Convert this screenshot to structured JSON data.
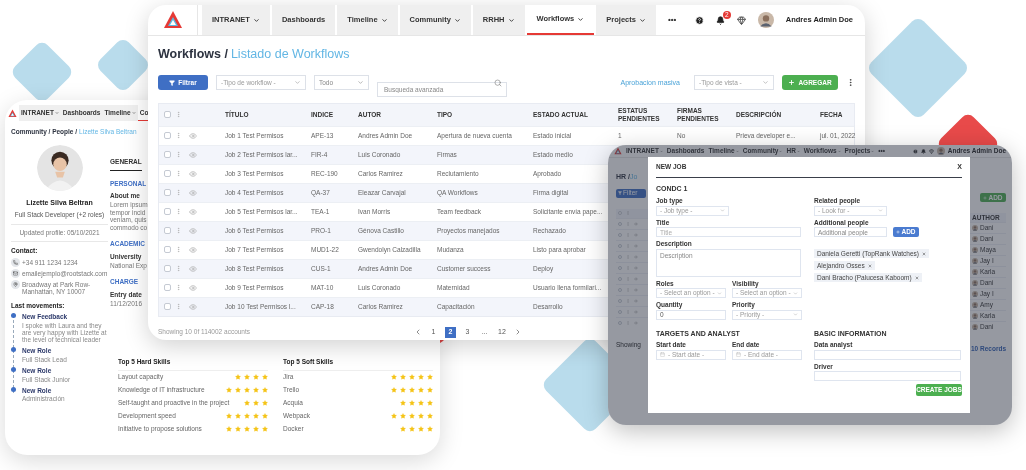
{
  "profile_window": {
    "nav": [
      {
        "label": "INTRANET",
        "dropdown": true,
        "selected": false
      },
      {
        "label": "Dashboards",
        "dropdown": false,
        "selected": false
      },
      {
        "label": "Timeline",
        "dropdown": true,
        "selected": false
      },
      {
        "label": "Co",
        "dropdown": false,
        "selected": true
      }
    ],
    "breadcrumb": "Community / People / ",
    "current": "Lizette Silva Beltran",
    "name": "Lizette Silva Beltran",
    "role": "Full Stack Developer (+2 roles)",
    "updated": "Updated profile: 05/10/2021",
    "contact_title": "Contact:",
    "contacts": [
      {
        "kind": "phone",
        "text": "+34 911 1234 1234"
      },
      {
        "kind": "email",
        "text": "emailejemplo@rootstack.com"
      },
      {
        "kind": "address",
        "text": "Broadway at Park Row-Manhattan, NY 10007"
      }
    ],
    "movements_title": "Last movements:",
    "movements": [
      {
        "title": "New Feedback",
        "text": "I spoke with Laura and they are very happy with Lizette at the level of technical leader"
      },
      {
        "title": "New Role",
        "text": "Full Stack Lead"
      },
      {
        "title": "New Role",
        "text": "Full Stack Junior"
      },
      {
        "title": "New Role",
        "text": "Administración"
      }
    ],
    "side": [
      {
        "kind": "tab",
        "text": "GENERAL",
        "selected": true
      },
      {
        "kind": "heading",
        "text": "PERSONAL"
      },
      {
        "kind": "label",
        "text": "About me"
      },
      {
        "kind": "text",
        "text": "Lorem ipsum"
      },
      {
        "kind": "text",
        "text": "tempor incid"
      },
      {
        "kind": "text",
        "text": "veniam, quis"
      },
      {
        "kind": "text",
        "text": "commodo co"
      },
      {
        "kind": "heading",
        "text": "ACADEMIC"
      },
      {
        "kind": "label",
        "text": "University"
      },
      {
        "kind": "text",
        "text": "National Exp"
      },
      {
        "kind": "heading",
        "text": "CHARGE"
      },
      {
        "kind": "label",
        "text": "Entry date"
      },
      {
        "kind": "text",
        "text": "11/12/2016"
      }
    ],
    "skills": [
      {
        "title": "Top 5 Hard Skills",
        "items": [
          {
            "label": "Layout capacity",
            "stars": 4
          },
          {
            "label": "Knowledge of IT infrastructure",
            "stars": 5
          },
          {
            "label": "Self-taught and proactive in the project",
            "stars": 3
          },
          {
            "label": "Development speed",
            "stars": 5
          },
          {
            "label": "Initiative to propose solutions",
            "stars": 5
          }
        ]
      },
      {
        "title": "Top 5 Soft Skills",
        "items": [
          {
            "label": "Jira",
            "stars": 5
          },
          {
            "label": "Trello",
            "stars": 5
          },
          {
            "label": "Acquia",
            "stars": 4
          },
          {
            "label": "Webpack",
            "stars": 5
          },
          {
            "label": "Docker",
            "stars": 4
          }
        ]
      }
    ]
  },
  "workflows_window": {
    "nav": [
      {
        "label": "INTRANET",
        "dropdown": true,
        "selected": false
      },
      {
        "label": "Dashboards",
        "dropdown": false,
        "selected": false
      },
      {
        "label": "Timeline",
        "dropdown": true,
        "selected": false
      },
      {
        "label": "Community",
        "dropdown": true,
        "selected": false
      },
      {
        "label": "RRHH",
        "dropdown": true,
        "selected": false
      },
      {
        "label": "Workflows",
        "dropdown": true,
        "selected": true
      },
      {
        "label": "Projects",
        "dropdown": true,
        "selected": false
      }
    ],
    "more": "•••",
    "notifications": "2",
    "user": "Andres Admin Doe",
    "breadcrumb": "Workflows / ",
    "title": "Listado de Workflows",
    "filter_button": "Filtrar",
    "workflow_type": {
      "placeholder": "-Tipo de workflow -"
    },
    "scope": {
      "value": "Todo"
    },
    "search": {
      "placeholder": "Busqueda avanzada"
    },
    "bulk_approval": "Aprobacion masiva",
    "view_type": {
      "placeholder": "-Tipo de vista -"
    },
    "add_button": "AGREGAR",
    "table": {
      "all_checked": false,
      "columns": [
        "TÍTULO",
        "INDICE",
        "AUTOR",
        "TIPO",
        "ESTADO ACTUAL",
        "ESTATUS PENDIENTES",
        "FIRMAS PENDIENTES",
        "DESCRIPCIÓN",
        "FECHA"
      ],
      "rows": [
        {
          "checked": false,
          "cells": [
            "Job 1 Test Permisos",
            "APE-13",
            "Andres Admin Doe",
            "Apertura de nueva cuenta",
            "Estado inicial",
            "1",
            "No",
            "Prieva developer e...",
            "jul. 01, 2022"
          ]
        },
        {
          "checked": false,
          "cells": [
            "Job 2 Test Permisos lar...",
            "FIR-4",
            "Luis Coronado",
            "Firmas",
            "Estado medio"
          ]
        },
        {
          "checked": false,
          "cells": [
            "Job 3 Test Permisos",
            "REC-190",
            "Carlos Ramirez",
            "Reclutamiento",
            "Aprobado"
          ]
        },
        {
          "checked": false,
          "cells": [
            "Job 4 Test Permisos",
            "QA-37",
            "Eleazar Carvajal",
            "QA Workflows",
            "Firma digital"
          ]
        },
        {
          "checked": false,
          "cells": [
            "Job 5 Test Permisos lar...",
            "TEA-1",
            "Ivan Morris",
            "Team feedback",
            "Solicitante envía pape..."
          ]
        },
        {
          "checked": false,
          "cells": [
            "Job 6 Test Permisos",
            "PRO-1",
            "Génova Castillo",
            "Proyectos manejados",
            "Rechazado"
          ]
        },
        {
          "checked": false,
          "cells": [
            "Job 7 Test Permisos",
            "MUD1-22",
            "Gwendolyn Calzadilla",
            "Mudanza",
            "Listo para aprobar"
          ]
        },
        {
          "checked": false,
          "cells": [
            "Job 8 Test Permisos",
            "CUS-1",
            "Andres Admin Doe",
            "Customer success",
            "Deploy"
          ]
        },
        {
          "checked": false,
          "cells": [
            "Job 9 Test Permisos",
            "MAT-10",
            "Luis Coronado",
            "Maternidad",
            "Usuario llena formilari..."
          ]
        },
        {
          "checked": false,
          "cells": [
            "Job 10 Test Permisos l...",
            "CAP-18",
            "Carlos Ramirez",
            "Capacitación",
            "Desarrollo"
          ]
        }
      ]
    },
    "footer": "Showing 10 0f 114002 accounts",
    "pages": [
      {
        "label": "1",
        "selected": false
      },
      {
        "label": "2",
        "selected": true
      },
      {
        "label": "3",
        "selected": false
      },
      {
        "label": "...",
        "selected": false
      },
      {
        "label": "12",
        "selected": false
      }
    ]
  },
  "hr_window": {
    "nav": [
      {
        "label": "INTRANET",
        "dropdown": true
      },
      {
        "label": "Dashboards",
        "dropdown": false
      },
      {
        "label": "Timeline",
        "dropdown": true
      },
      {
        "label": "Community",
        "dropdown": true
      },
      {
        "label": "HR",
        "dropdown": true
      },
      {
        "label": "Workflows",
        "dropdown": true
      },
      {
        "label": "Projects",
        "dropdown": true
      }
    ],
    "more": "•••",
    "user": "Andres Admin Doe",
    "breadcrumb": "HR / ",
    "title": "Jo",
    "filter_button": "Filter",
    "add_button": "ADD",
    "author_column": "AUTHOR",
    "all_checked": false,
    "rows": [
      {
        "checked": false,
        "author": "Dani"
      },
      {
        "checked": false,
        "author": "Dani"
      },
      {
        "checked": false,
        "author": "Maya"
      },
      {
        "checked": false,
        "author": "Jay I"
      },
      {
        "checked": false,
        "author": "Karla"
      },
      {
        "checked": false,
        "author": "Dani"
      },
      {
        "checked": false,
        "author": "Jay I"
      },
      {
        "checked": false,
        "author": "Amy"
      },
      {
        "checked": false,
        "author": "Karla"
      },
      {
        "checked": false,
        "author": "Dani"
      }
    ],
    "footer": "Showing",
    "records": "10 Records",
    "modal": {
      "title": "NEW JOB",
      "close": "X",
      "section": "CONDC 1",
      "left_fields": [
        {
          "kind": "select",
          "label": "Job type",
          "placeholder": "- Job type -"
        },
        {
          "kind": "input",
          "label": "Title",
          "placeholder": "Title"
        },
        {
          "kind": "textarea",
          "label": "Description",
          "placeholder": "Description"
        }
      ],
      "pair_fields": [
        {
          "kind": "select",
          "label": "Roles",
          "placeholder": "- Select an option -"
        },
        {
          "kind": "select",
          "label": "Visibility",
          "placeholder": "- Select an option -"
        },
        {
          "kind": "input",
          "label": "Quantity",
          "value": "0"
        },
        {
          "kind": "select",
          "label": "Priority",
          "placeholder": "- Priority -"
        }
      ],
      "related_people": {
        "label": "Related people",
        "placeholder": "- Look for -"
      },
      "additional_people": {
        "label": "Additional people",
        "placeholder": "Additional people"
      },
      "add_button": "ADD",
      "tags": [
        "Daniela Geretti (TopRank Watches)",
        "Alejandro Osses",
        "Dani Bracho (Palucesa Kaboom)"
      ],
      "targets_title": "TARGETS AND ANALYST",
      "dates": [
        {
          "label": "Start date",
          "placeholder": "- Start date -"
        },
        {
          "label": "End date",
          "placeholder": "- End date -"
        }
      ],
      "basic_title": "BASIC INFORMATION",
      "basic_fields": [
        {
          "label": "Data analyst"
        },
        {
          "label": "Driver"
        }
      ],
      "submit": "CREATE JOBS"
    }
  }
}
